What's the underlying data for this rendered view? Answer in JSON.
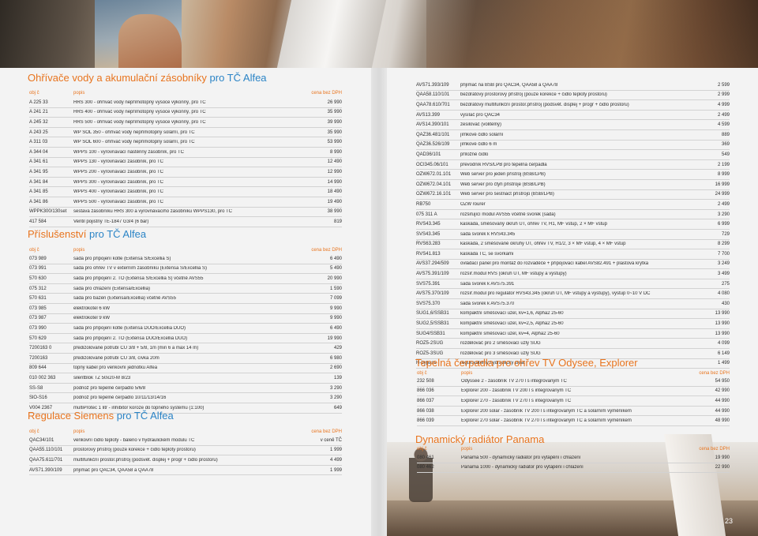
{
  "page_number": "23",
  "water_heaters": {
    "title_main": "Ohřívače vody a akumulační zásobníky",
    "title_sub": "pro TČ Alfea",
    "headers": {
      "code": "obj č",
      "desc": "popis",
      "price": "cena bez DPH"
    },
    "rows": [
      [
        "A 225 33",
        "HRS 300 - ohřívač vody nepřímotopný vysoce výkonný, pro TČ",
        "26 990"
      ],
      [
        "A 241 21",
        "HRS 400 - ohřívač vody nepřímotopný vysoce výkonný, pro TČ",
        "35 990"
      ],
      [
        "A 245 32",
        "HRS 500 - ohřívač vody nepřímotopný vysoce výkonný, pro TČ",
        "39 990"
      ],
      [
        "A 243 25",
        "WP SOL 350 - ohřívač vody nepřímotopný solární, pro TČ",
        "35 990"
      ],
      [
        "A 311 03",
        "WP SOL 600 - ohřívač vody nepřímotopný solární, pro TČ",
        "53 990"
      ],
      [
        "A 344 04",
        "WPPS 100 - vyrovnávací nástěnný zásobník, pro TČ",
        "8 990"
      ],
      [
        "A 341 61",
        "WPPS 130 - vyrovnávací zásobník, pro TČ",
        "12 490"
      ],
      [
        "A 341 95",
        "WPPS 200 - vyrovnávací zásobník, pro TČ",
        "12 990"
      ],
      [
        "A 341 84",
        "WPPS 300 - vyrovnávací zásobník, pro TČ",
        "14 990"
      ],
      [
        "A 341 85",
        "WPPS 400 - vyrovnávací zásobník, pro TČ",
        "18 490"
      ],
      [
        "A 341 86",
        "WPPS 500 - vyrovnávací zásobník, pro TČ",
        "19 490"
      ],
      [
        "WPPK300/130set",
        "sestava zásobníku HRS 300 a vyrovnávacího zásobníku WPPS130, pro TČ",
        "38 990"
      ],
      [
        "417 584",
        "Ventil pojistný TE-1847 G3/4 (6 bar)",
        "819"
      ]
    ]
  },
  "accessories": {
    "title_main": "Příslušenství",
    "title_sub": "pro TČ Alfea",
    "headers": {
      "code": "obj č",
      "desc": "popis",
      "price": "cena bez DPH"
    },
    "rows": [
      [
        "073 989",
        "sada pro připojení kotle (Extensa S/Excellia S)",
        "6 490"
      ],
      [
        "073 991",
        "sada pro ohřev TV v externím zásobníku (Extensa S/Excellia S)",
        "5 490"
      ],
      [
        "570 630",
        "sada pro připojení 2. TO (Extensa S/Excellia S) včetně AVS55",
        "20 990"
      ],
      [
        "075 312",
        "sada pro chlazení (Extensa/Excellia)",
        "1 590"
      ],
      [
        "570 631",
        "sada pro bazén (Extensa/Excellia) včetně AVS55",
        "7 099"
      ],
      [
        "073 985",
        "elektrokotel 6 kW",
        "9 990"
      ],
      [
        "073 987",
        "elektrokotel 9 kW",
        "9 990"
      ],
      [
        "073 990",
        "sada pro připojení kotle (Extensa DUO/Excellia DUO)",
        "6 490"
      ],
      [
        "570 629",
        "sada pro připojení 2. TO (Extensa DUO/Excellia DUO)",
        "19 990"
      ],
      [
        "7200163 0",
        "předizolované potrubí CU 3/8 + 5/8, 1m (min 6 a max 14 m)",
        "429"
      ],
      [
        "7200163",
        "předizolované potrubí CU 3/8, cívka 20m",
        "6 980"
      ],
      [
        "809 644",
        "topný kabel pro venkovní jednotku Alfea",
        "2 690"
      ],
      [
        "010 002 363",
        "silentblok TZ 50x20-M 8/23",
        "139"
      ],
      [
        "SS-S8",
        "podnož pro tepelné čerpadlo 5/6/8",
        "3 290"
      ],
      [
        "SlO-S16",
        "podnož pro tepelné čerpadlo 10/11/13/14/16",
        "3 290"
      ],
      [
        "V004 2367",
        "multiProtec 1 litr - inhibitor koroze do topného systému (1:100)",
        "649"
      ]
    ]
  },
  "siemens": {
    "title_main": "Regulace Siemens",
    "title_sub": "pro TČ Alfea",
    "headers": {
      "code": "obj č",
      "desc": "popis",
      "price": "cena bez DPH"
    },
    "rows": [
      [
        "QAC34/101",
        "venkovní čidlo teploty - baleno v hydraulickém modulu TČ",
        "v ceně TČ"
      ],
      [
        "QAA55.110/101",
        "prostorový přístroj (pouze korekce + čidlo teploty prostoru)",
        "1 999"
      ],
      [
        "QAA75.611/701",
        "multifunkční prostor.přístroj (podsvět. displej + progr + čidlo prostoru)",
        "4 499"
      ],
      [
        "AVS71.390/109",
        "přijímač pro QAC34, QAA58 a QAA78",
        "1 999"
      ]
    ]
  },
  "siemens_cont": {
    "rows": [
      [
        "AVS71.393/109",
        "přijímač na BSB pro QAC34, QAA58 a QAA78",
        "2 599"
      ],
      [
        "QAA58.110/101",
        "bezdrátový prostorový přístroj (pouze korekce + čidlo teploty prostoru)",
        "2 999"
      ],
      [
        "QAA78.610/701",
        "bezdrátový multifunkční prostor.přístroj (podsvět. displej + progr + čidlo prostoru)",
        "4 999"
      ],
      [
        "AVS13.399",
        "vysílač pro QAC34",
        "2 499"
      ],
      [
        "AVS14.390/101",
        "zesilovač (volitelný)",
        "4 599"
      ],
      [
        "QAZ36.481/101",
        "jímkové čidlo solární",
        "889"
      ],
      [
        "QAZ36.526/109",
        "jímkové čidlo 6 m",
        "369"
      ],
      [
        "QAD36/101",
        "příložné čidlo",
        "549"
      ],
      [
        "OCI345.06/101",
        "převodník RVS/LPB pro tepelná čerpadla",
        "2 199"
      ],
      [
        "OZW672.01.101",
        "Web server pro jeden přístroj (BSB/LPB)",
        "8 999"
      ],
      [
        "OZW672.04.101",
        "Web server pro čtyři přístroje (BSB/LPB)",
        "16 999"
      ],
      [
        "OZW672.16.101",
        "Web server pro šestnáct přístrojů (BSB/LPB)",
        "24 999"
      ],
      [
        "RB750",
        "OZW rourer",
        "2 499"
      ],
      [
        "075 311 A",
        "rozšiřující modul AVS55 včetně svorek (sada)",
        "3 290"
      ],
      [
        "RVS43.345",
        "kaskáda, směšovaný okruh ÚT, ohřev TV, H1, MF vstup, 2 × MF vstup",
        "6 999"
      ],
      [
        "SVS43.345",
        "sada svorek k RVS43.345",
        "729"
      ],
      [
        "RVS63.283",
        "kaskáda, 2 směšované okruhy ÚT, ohřev TV, H1/2, 3 × MF vstup, 4 × MF vstup",
        "8 299"
      ],
      [
        "RVS41.813",
        "kaskáda TČ, se svorkami",
        "7 700"
      ],
      [
        "AVS37.294/509",
        "ovládací panel pro montáž do rozvaděče + připojovací kabel AVS82.491 + plastová krytka",
        "3 249"
      ],
      [
        "AVS75.391/109",
        "rozšíř.modul RVS (okruh ÚT, MF vstupy a výstupy)",
        "3 499"
      ],
      [
        "SVS75.391",
        "sada svorek k AVS75.391",
        "275"
      ],
      [
        "AVS75.370/109",
        "rozšíř.modul pro regulátor RVS43.345 (okruh ÚT, MF vstupy a výstupy), výstup 0~10 V DC",
        "4 080"
      ],
      [
        "SVS75.370",
        "sada svorek k AVS75.370",
        "430"
      ],
      [
        "SUG1,6/SSB31",
        "kompaktní směšovací uzel, kv=1,6, Alpha2 25-60",
        "13 990"
      ],
      [
        "SUG2,5/SSB31",
        "kompaktní směšovací uzel, kv=2,5, Alpha2 25-60",
        "13 990"
      ],
      [
        "SUG4/SSB31",
        "kompaktní směšovací uzel, kv=4, Alpha2 25-60",
        "13 990"
      ],
      [
        "ROZ5-2SUG",
        "rozdělovač pro 2 směšovací uzly SUG",
        "4 099"
      ],
      [
        "ROZ5-3SUG",
        "rozdělovač pro 3 směšovací uzly SUG",
        "6 149"
      ],
      [
        "H-bypass",
        "regulovatelný hydraulický zkrat",
        "1 499"
      ]
    ]
  },
  "tv_pump": {
    "title_main": "Tepelná čerpadla pro ohřev TV",
    "title_sub": "Odysee, Explorer",
    "headers": {
      "code": "obj č",
      "desc": "popis",
      "price": "cena bez DPH"
    },
    "rows": [
      [
        "232 508",
        "Odyssee 2 - zásobník TV 270 l s integrovaným TČ",
        "54 950"
      ],
      [
        "866 036",
        "Explorer 200 - zásobník TV 200 l s integrovaným TČ",
        "42 990"
      ],
      [
        "866 037",
        "Explorer 270 - zásobník TV 270 l s integrovaným TČ",
        "44 990"
      ],
      [
        "866 038",
        "Explorer 200 solar - zásobník TV 200 l s integrovaným TČ a solárním výměníkem",
        "44 990"
      ],
      [
        "866 039",
        "Explorer 270 solar - zásobník TV 270 l s integrovaným TČ a solárním výměníkem",
        "48 990"
      ]
    ]
  },
  "radiator": {
    "title_main": "Dynamický radiátor",
    "title_sub": "Panama",
    "headers": {
      "code": "obj č",
      "desc": "popis",
      "price": "cena bez DPH"
    },
    "rows": [
      [
        "080 461",
        "Panama 500 - dynamický radiátor pro vytápění i chlazení",
        "19 990"
      ],
      [
        "080 462",
        "Panama 1000 - dynamický radiátor pro vytápění i chlazení",
        "22 990"
      ]
    ]
  }
}
